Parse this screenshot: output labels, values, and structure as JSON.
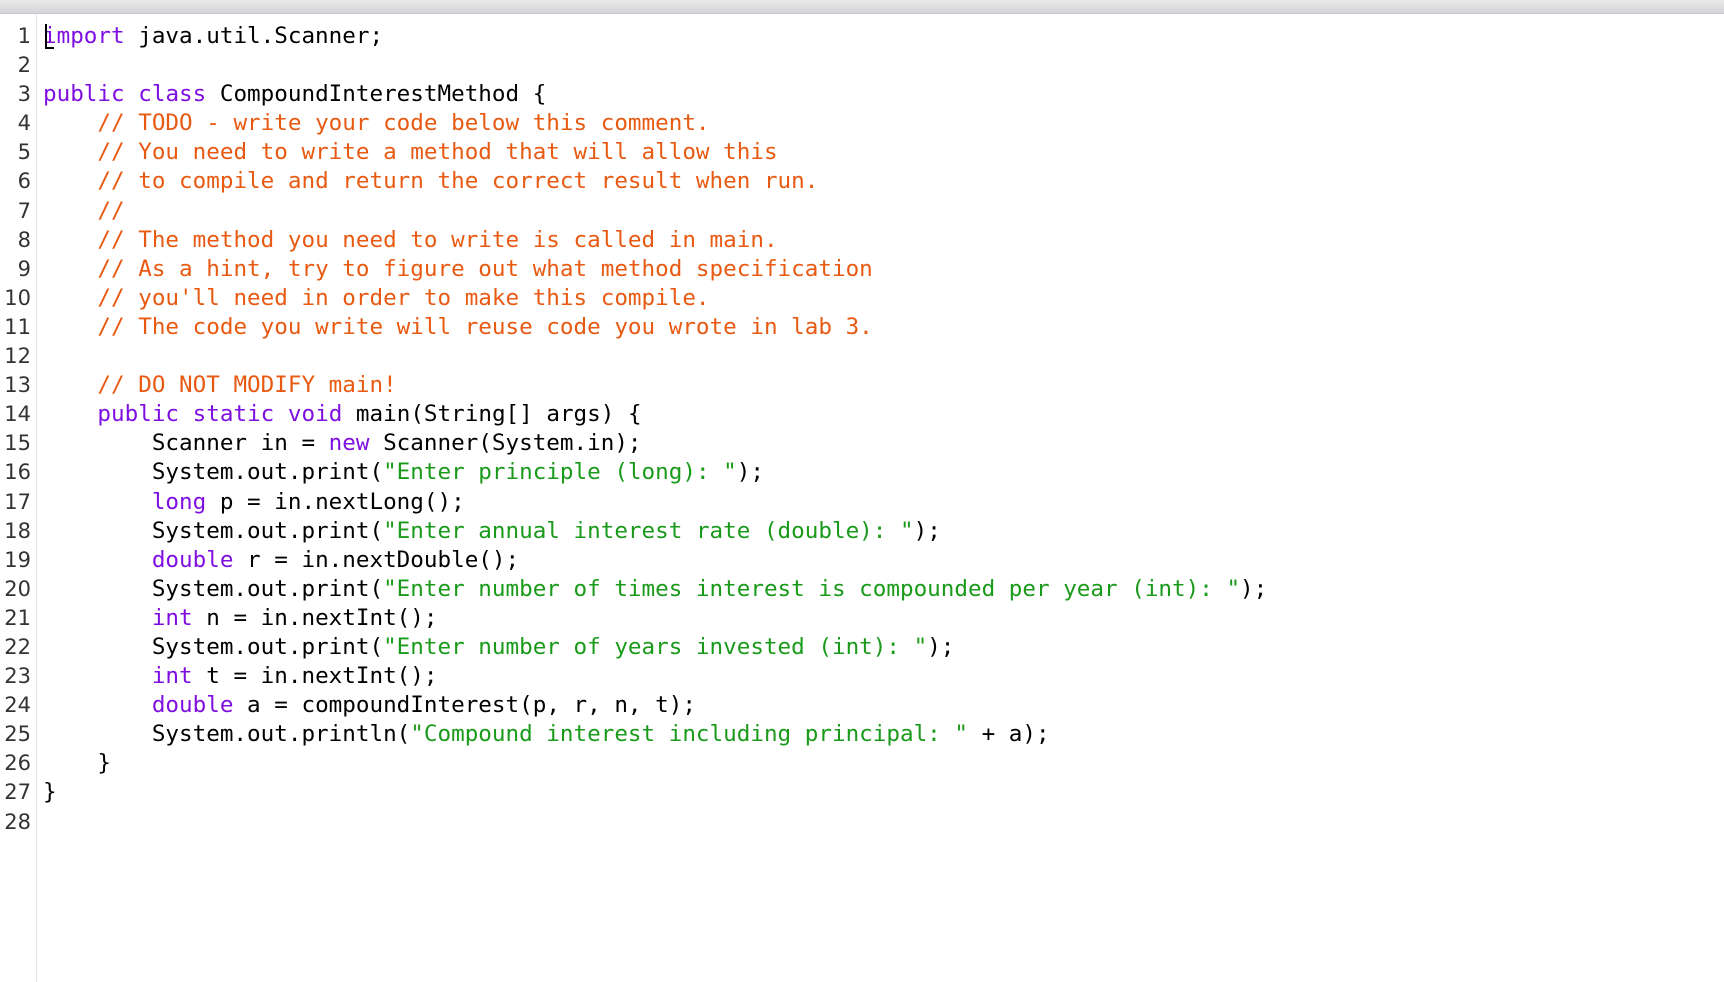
{
  "lines": [
    [
      {
        "t": "import",
        "c": "kw"
      },
      {
        "t": " java.util.Scanner;",
        "c": "tx"
      }
    ],
    [],
    [
      {
        "t": "public",
        "c": "kw"
      },
      {
        "t": " ",
        "c": "tx"
      },
      {
        "t": "class",
        "c": "kw"
      },
      {
        "t": " CompoundInterestMethod {",
        "c": "tx"
      }
    ],
    [
      {
        "t": "    ",
        "c": "tx"
      },
      {
        "t": "// TODO - write your code below this comment.",
        "c": "cm"
      }
    ],
    [
      {
        "t": "    ",
        "c": "tx"
      },
      {
        "t": "// You need to write a method that will allow this",
        "c": "cm"
      }
    ],
    [
      {
        "t": "    ",
        "c": "tx"
      },
      {
        "t": "// to compile and return the correct result when run.",
        "c": "cm"
      }
    ],
    [
      {
        "t": "    ",
        "c": "tx"
      },
      {
        "t": "//",
        "c": "cm"
      }
    ],
    [
      {
        "t": "    ",
        "c": "tx"
      },
      {
        "t": "// The method you need to write is called in main.",
        "c": "cm"
      }
    ],
    [
      {
        "t": "    ",
        "c": "tx"
      },
      {
        "t": "// As a hint, try to figure out what method specification",
        "c": "cm"
      }
    ],
    [
      {
        "t": "    ",
        "c": "tx"
      },
      {
        "t": "// you'll need in order to make this compile.",
        "c": "cm"
      }
    ],
    [
      {
        "t": "    ",
        "c": "tx"
      },
      {
        "t": "// The code you write will reuse code you wrote in lab 3.",
        "c": "cm"
      }
    ],
    [],
    [
      {
        "t": "    ",
        "c": "tx"
      },
      {
        "t": "// DO NOT MODIFY main!",
        "c": "cm"
      }
    ],
    [
      {
        "t": "    ",
        "c": "tx"
      },
      {
        "t": "public",
        "c": "kw"
      },
      {
        "t": " ",
        "c": "tx"
      },
      {
        "t": "static",
        "c": "kw"
      },
      {
        "t": " ",
        "c": "tx"
      },
      {
        "t": "void",
        "c": "kw"
      },
      {
        "t": " main(String[] args) {",
        "c": "tx"
      }
    ],
    [
      {
        "t": "        Scanner in = ",
        "c": "tx"
      },
      {
        "t": "new",
        "c": "kw"
      },
      {
        "t": " Scanner(System.in);",
        "c": "tx"
      }
    ],
    [
      {
        "t": "        System.out.print(",
        "c": "tx"
      },
      {
        "t": "\"Enter principle (long): \"",
        "c": "st"
      },
      {
        "t": ");",
        "c": "tx"
      }
    ],
    [
      {
        "t": "        ",
        "c": "tx"
      },
      {
        "t": "long",
        "c": "kw"
      },
      {
        "t": " p = in.nextLong();",
        "c": "tx"
      }
    ],
    [
      {
        "t": "        System.out.print(",
        "c": "tx"
      },
      {
        "t": "\"Enter annual interest rate (double): \"",
        "c": "st"
      },
      {
        "t": ");",
        "c": "tx"
      }
    ],
    [
      {
        "t": "        ",
        "c": "tx"
      },
      {
        "t": "double",
        "c": "kw"
      },
      {
        "t": " r = in.nextDouble();",
        "c": "tx"
      }
    ],
    [
      {
        "t": "        System.out.print(",
        "c": "tx"
      },
      {
        "t": "\"Enter number of times interest is compounded per year (int): \"",
        "c": "st"
      },
      {
        "t": ");",
        "c": "tx"
      }
    ],
    [
      {
        "t": "        ",
        "c": "tx"
      },
      {
        "t": "int",
        "c": "kw"
      },
      {
        "t": " n = in.nextInt();",
        "c": "tx"
      }
    ],
    [
      {
        "t": "        System.out.print(",
        "c": "tx"
      },
      {
        "t": "\"Enter number of years invested (int): \"",
        "c": "st"
      },
      {
        "t": ");",
        "c": "tx"
      }
    ],
    [
      {
        "t": "        ",
        "c": "tx"
      },
      {
        "t": "int",
        "c": "kw"
      },
      {
        "t": " t = in.nextInt();",
        "c": "tx"
      }
    ],
    [
      {
        "t": "        ",
        "c": "tx"
      },
      {
        "t": "double",
        "c": "kw"
      },
      {
        "t": " a = compoundInterest(p, r, n, t);",
        "c": "tx"
      }
    ],
    [
      {
        "t": "        System.out.println(",
        "c": "tx"
      },
      {
        "t": "\"Compound interest including principal: \"",
        "c": "st"
      },
      {
        "t": " + a);",
        "c": "tx"
      }
    ],
    [
      {
        "t": "    }",
        "c": "tx"
      }
    ],
    [
      {
        "t": "}",
        "c": "tx"
      }
    ],
    []
  ],
  "colors": {
    "keyword": "#7f0fe0",
    "comment": "#e85a12",
    "string": "#1a9a1a",
    "text": "#000000",
    "line_number": "#333333"
  }
}
